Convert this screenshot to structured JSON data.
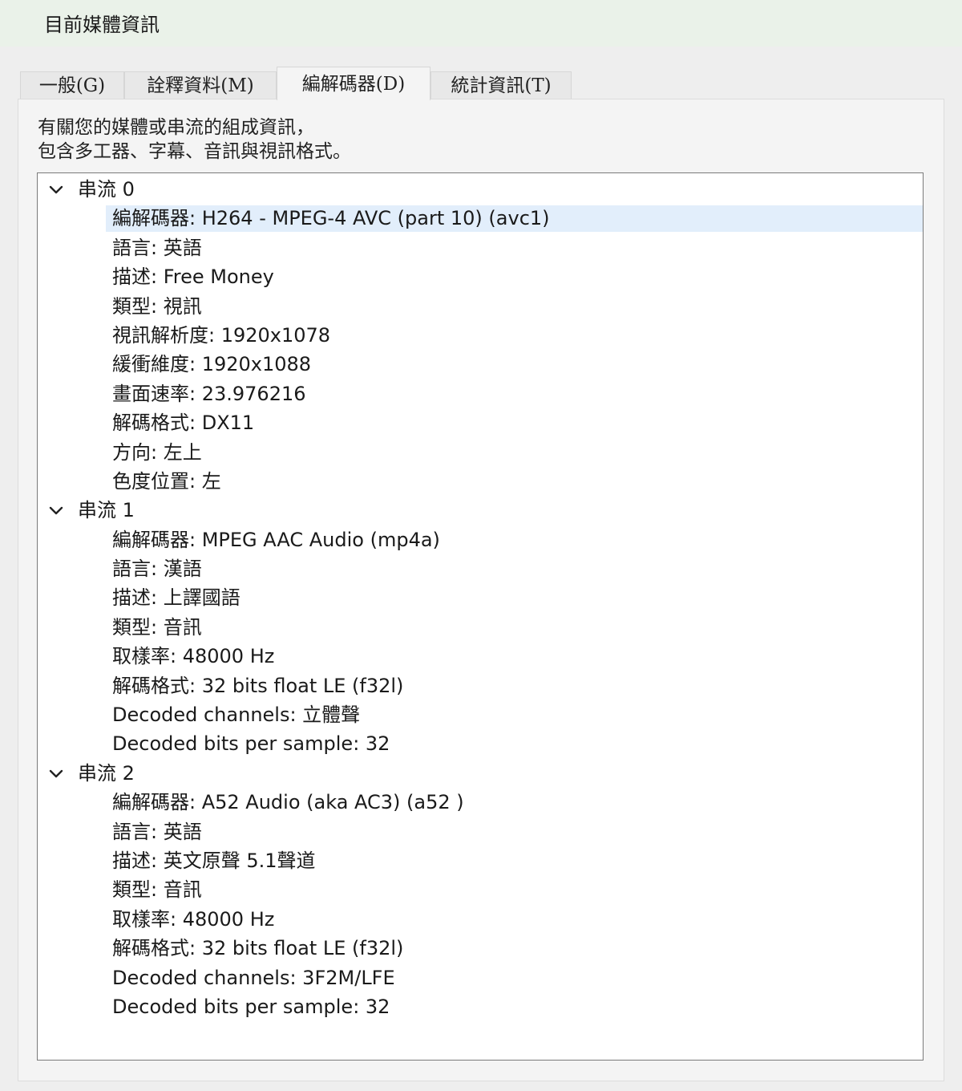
{
  "window": {
    "title": "目前媒體資訊"
  },
  "tabs": [
    {
      "label": "一般(G)",
      "active": false
    },
    {
      "label": "詮釋資料(M)",
      "active": false
    },
    {
      "label": "編解碼器(D)",
      "active": true
    },
    {
      "label": "統計資訊(T)",
      "active": false
    }
  ],
  "description": {
    "line1": "有關您的媒體或串流的組成資訊，",
    "line2": "包含多工器、字幕、音訊與視訊格式。"
  },
  "streams": [
    {
      "label": "串流 0",
      "expanded": true,
      "items": [
        "編解碼器: H264 - MPEG-4 AVC (part 10) (avc1)",
        "語言: 英語",
        "描述: Free Money",
        "類型: 視訊",
        "視訊解析度: 1920x1078",
        "緩衝維度: 1920x1088",
        "畫面速率: 23.976216",
        "解碼格式: DX11",
        "方向: 左上",
        "色度位置: 左"
      ]
    },
    {
      "label": "串流 1",
      "expanded": true,
      "items": [
        "編解碼器: MPEG AAC Audio (mp4a)",
        "語言: 漢語",
        "描述: 上譯國語",
        "類型: 音訊",
        "取樣率: 48000 Hz",
        "解碼格式: 32 bits float LE (f32l)",
        "Decoded channels: 立體聲",
        "Decoded bits per sample: 32"
      ]
    },
    {
      "label": "串流 2",
      "expanded": true,
      "items": [
        "編解碼器: A52 Audio (aka AC3) (a52 )",
        "語言: 英語",
        "描述: 英文原聲 5.1聲道",
        "類型: 音訊",
        "取樣率: 48000 Hz",
        "解碼格式: 32 bits float LE (f32l)",
        "Decoded channels: 3F2M/LFE",
        "Decoded bits per sample: 32"
      ]
    }
  ],
  "colors": {
    "titlebar": "#eaf2e9",
    "selection": "#e2eefb"
  },
  "icons": {
    "expand": "chevron-down-icon"
  }
}
